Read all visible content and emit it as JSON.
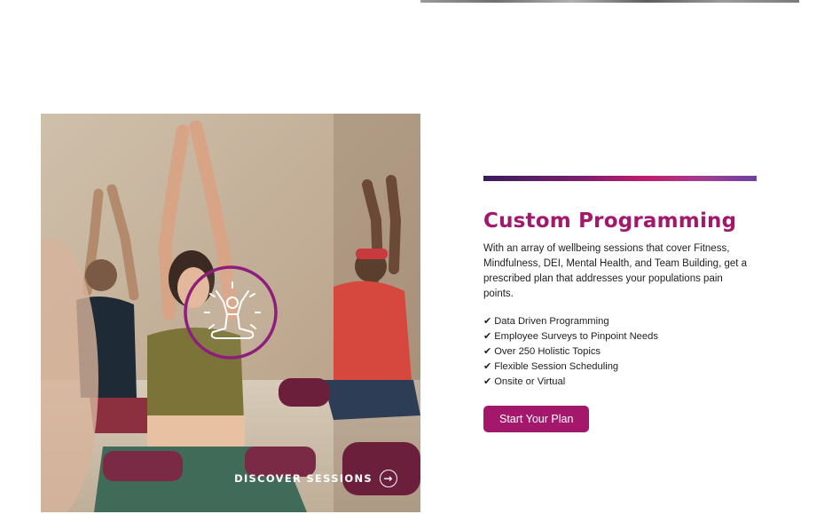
{
  "image": {
    "overlay_badge_icon": "meditation-icon",
    "discover_label": "DISCOVER SESSIONS",
    "discover_arrow": "→"
  },
  "section": {
    "title": "Custom Programming",
    "description": "With an array of wellbeing sessions that cover Fitness, Mindfulness, DEI, Mental Health, and Team Building, get a prescribed plan that addresses your populations pain points.",
    "check_glyph": "✔",
    "features": [
      "Data Driven Programming",
      "Employee Surveys to Pinpoint Needs",
      "Over 250 Holistic Topics",
      "Flexible Session Scheduling",
      "Onsite or Virtual"
    ],
    "cta_label": "Start Your Plan"
  },
  "colors": {
    "brand": "#a3186b",
    "accent_gradient": [
      "#3a1b5c",
      "#7a1d6f",
      "#c11d6e",
      "#a23d90",
      "#6d3fa3"
    ]
  }
}
